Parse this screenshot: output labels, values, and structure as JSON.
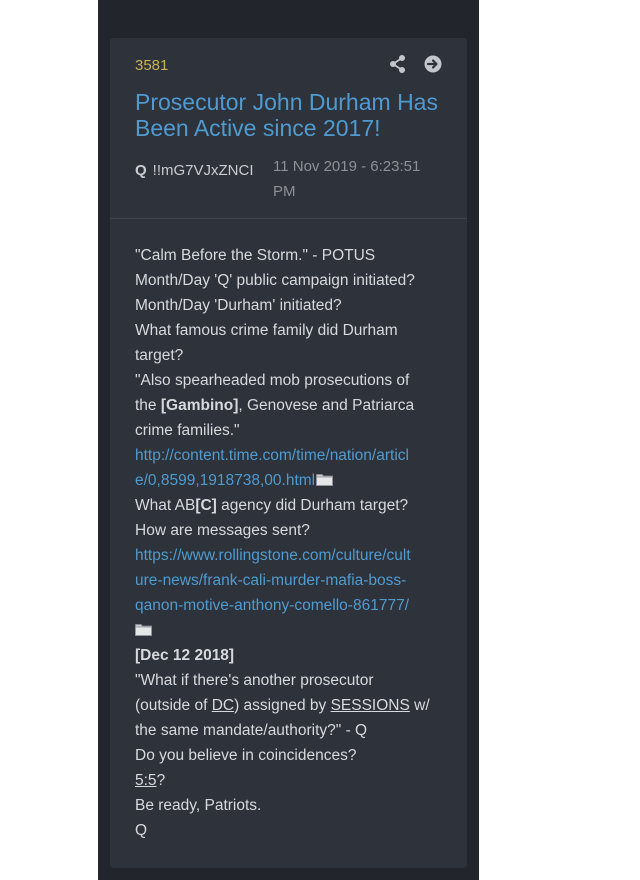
{
  "post": {
    "number": "3581",
    "title": "Prosecutor John Durham Has Been Active since 2017!",
    "author_name": "Q",
    "tripcode": "!!mG7VJxZNCI",
    "date": "11 Nov 2019 - 6:23:51 PM"
  },
  "icons": {
    "share": "share-icon",
    "open": "arrow-right-circle-icon",
    "folder": "folder-icon"
  },
  "colors": {
    "post_number": "#c8b25a",
    "title": "#4f9bd0",
    "link": "#4f9bd0",
    "card_bg": "#2e323a",
    "frame_bg": "#22262c"
  },
  "body": {
    "line1": "\"Calm Before the Storm.\" - POTUS",
    "line2": "Month/Day 'Q' public campaign initiated?",
    "line3": "Month/Day 'Durham' initiated?",
    "line4a": "What famous crime family did Durham",
    "line4b": "target?",
    "line5a": "\"Also spearheaded mob prosecutions of",
    "line5b_pre": "the ",
    "line5b_bold": "[Gambino]",
    "line5b_post": ", Genovese and Patriarca",
    "line5c": "crime families.\"",
    "link1a": "http://content.time.com/time/nation/articl",
    "link1b": "e/0,8599,1918738,00.html",
    "line6_pre": "What AB",
    "line6_bold": "[C]",
    "line6_post": " agency did Durham target?",
    "line7": "How are messages sent?",
    "link2a": "https://www.rollingstone.com/culture/cult",
    "link2b": "ure-news/frank-cali-murder-mafia-boss-",
    "link2c": "qanon-motive-anthony-comello-861777/",
    "date_ref": "[Dec 12 2018]",
    "q1": "\"What if there's another prosecutor",
    "q2_pre": "(outside of ",
    "q2_dc": "DC",
    "q2_mid": ") assigned by ",
    "q2_sessions": "SESSIONS",
    "q2_post": " w/",
    "q3": "the same mandate/authority?\" - Q",
    "line8": "Do you believe in coincidences?",
    "line9_u": "5:5",
    "line9_post": "?",
    "line10": "Be ready, Patriots.",
    "sign": "Q"
  }
}
